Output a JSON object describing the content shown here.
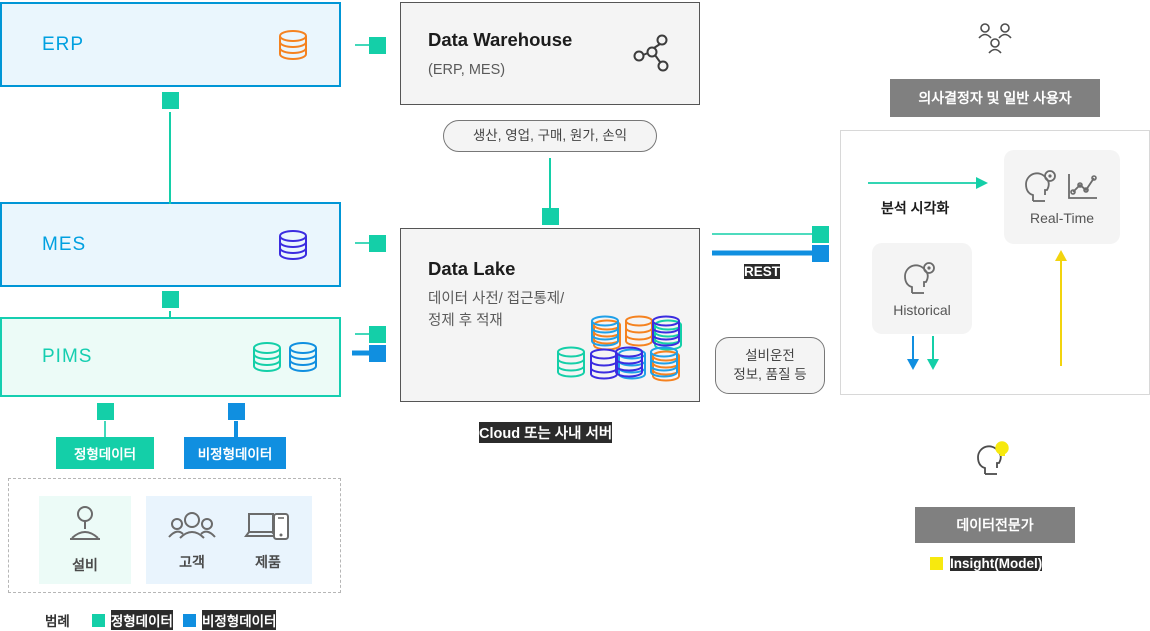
{
  "source_systems": [
    {
      "id": "erp",
      "label": "ERP",
      "icon": "database-icon",
      "icon_color": "#f5821f",
      "border": "#0096d6",
      "fill": "#eaf6fd"
    },
    {
      "id": "mes",
      "label": "MES",
      "icon": "database-icon",
      "icon_color": "#3b2ce0",
      "border": "#0096d6",
      "fill": "#eaf6fd"
    },
    {
      "id": "pims",
      "label": "PIMS",
      "icon": "double-database-icon",
      "icon_color": "#15ceb0",
      "border": "#15ceb0",
      "fill": "#ecfbf7"
    }
  ],
  "data_categories": {
    "structured": {
      "label": "정형데이터",
      "color": "#14cfa8"
    },
    "unstructured": {
      "label": "비정형데이터",
      "color": "#108fe0"
    }
  },
  "domain_cards": [
    {
      "id": "equipment",
      "label": "설비",
      "icon": "equipment-icon"
    },
    {
      "id": "customer",
      "label": "고객",
      "icon": "people-icon"
    },
    {
      "id": "product",
      "label": "제품",
      "icon": "devices-icon"
    }
  ],
  "legend": {
    "title": "범례",
    "items": [
      {
        "label": "정형데이터",
        "color": "#14cfa8",
        "selected": true
      },
      {
        "label": "비정형데이터",
        "color": "#108fe0",
        "selected": true
      }
    ]
  },
  "stages": {
    "warehouse": {
      "title": "Data Warehouse",
      "subtitle": "(ERP, MES)",
      "icon": "share-nodes-icon",
      "note": "생산, 영업, 구매, 원가, 손익"
    },
    "lake": {
      "title": "Data Lake",
      "subtitle_line1": "데이터 사전/ 접근통제/",
      "subtitle_line2": "정제 후 적재",
      "icon": "database-cluster-icon",
      "caption": "Cloud 또는 사내 서버",
      "caption_selected": true
    }
  },
  "connectors": {
    "rest_label": "REST",
    "rest_label_selected": true,
    "equipment_note_line1": "설비운전",
    "equipment_note_line2": "정보, 품질 등"
  },
  "consumers": {
    "users_chip": "의사결정자 및 일반 사용자",
    "users_icon": "people-group-icon",
    "visualization_label": "분석 시각화",
    "cards": [
      {
        "id": "realtime",
        "label": "Real-Time",
        "icon": "brain-chart-icon"
      },
      {
        "id": "historical",
        "label": "Historical",
        "icon": "brain-icon"
      }
    ],
    "expert_chip": "데이터전문가",
    "expert_icon": "brain-bulb-icon",
    "insight_legend": {
      "label": "Insight(Model)",
      "color": "#f7e90e",
      "selected": true
    }
  },
  "colors": {
    "teal": "#14cfa8",
    "blue": "#108fe0",
    "sky": "#0096d6",
    "orange": "#f5821f",
    "indigo": "#3b2ce0",
    "yellow": "#f7e90e",
    "grey_chip": "#808080",
    "stage_bg": "#f4f4f4"
  }
}
